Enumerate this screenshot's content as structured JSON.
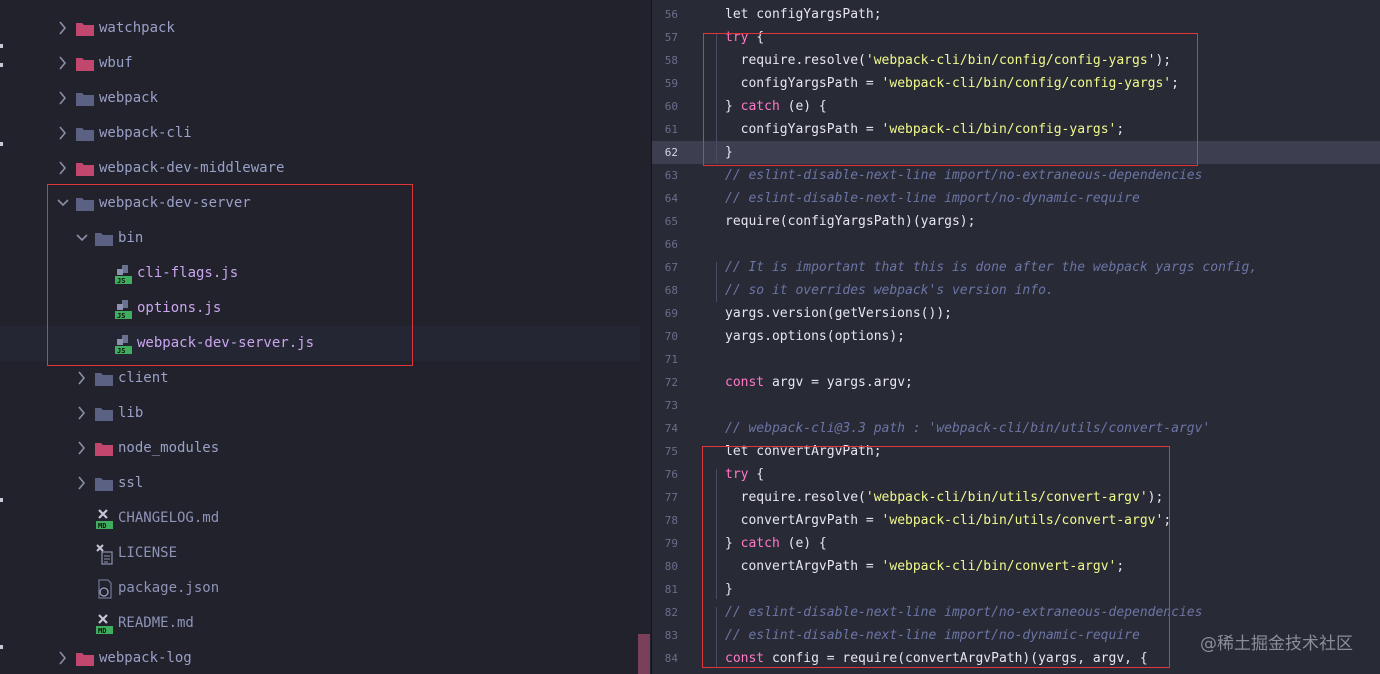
{
  "file_tree": {
    "items": [
      {
        "label": "watchpack",
        "type": "folder",
        "expanded": false,
        "color": "#c2476e"
      },
      {
        "label": "wbuf",
        "type": "folder",
        "expanded": false,
        "color": "#c2476e"
      },
      {
        "label": "webpack",
        "type": "folder",
        "expanded": false,
        "color": "#5b6183"
      },
      {
        "label": "webpack-cli",
        "type": "folder",
        "expanded": false,
        "color": "#5b6183"
      },
      {
        "label": "webpack-dev-middleware",
        "type": "folder",
        "expanded": false,
        "color": "#c2476e"
      },
      {
        "label": "webpack-dev-server",
        "type": "folder",
        "expanded": true,
        "color": "#5b6183"
      },
      {
        "label": "bin",
        "type": "folder",
        "expanded": true,
        "color": "#5b6183"
      },
      {
        "label": "cli-flags.js",
        "type": "js-file",
        "badge": "JS"
      },
      {
        "label": "options.js",
        "type": "js-file",
        "badge": "JS"
      },
      {
        "label": "webpack-dev-server.js",
        "type": "js-file",
        "badge": "JS"
      },
      {
        "label": "client",
        "type": "folder",
        "expanded": false,
        "color": "#5b6183"
      },
      {
        "label": "lib",
        "type": "folder",
        "expanded": false,
        "color": "#5b6183"
      },
      {
        "label": "node_modules",
        "type": "folder",
        "expanded": false,
        "color": "#c2476e"
      },
      {
        "label": "ssl",
        "type": "folder",
        "expanded": false,
        "color": "#5b6183"
      },
      {
        "label": "CHANGELOG.md",
        "type": "md-file",
        "badge": "MD"
      },
      {
        "label": "LICENSE",
        "type": "text-file"
      },
      {
        "label": "package.json",
        "type": "json-file"
      },
      {
        "label": "README.md",
        "type": "md-file",
        "badge": "MD"
      },
      {
        "label": "webpack-log",
        "type": "folder",
        "expanded": false,
        "color": "#c2476e"
      }
    ]
  },
  "editor": {
    "current_line": "62",
    "lines": [
      {
        "n": "56",
        "t": [
          [
            "p",
            "let configYargsPath;"
          ]
        ]
      },
      {
        "n": "57",
        "t": [
          [
            "k",
            "try"
          ],
          [
            "p",
            " {"
          ]
        ]
      },
      {
        "n": "58",
        "t": [
          [
            "p",
            "  require.resolve("
          ],
          [
            "s",
            "'webpack-cli/bin/config/config-yargs'"
          ],
          [
            "p",
            ");"
          ]
        ]
      },
      {
        "n": "59",
        "t": [
          [
            "p",
            "  configYargsPath = "
          ],
          [
            "s",
            "'webpack-cli/bin/config/config-yargs'"
          ],
          [
            "p",
            ";"
          ]
        ]
      },
      {
        "n": "60",
        "t": [
          [
            "p",
            "} "
          ],
          [
            "k",
            "catch"
          ],
          [
            "p",
            " (e) {"
          ]
        ]
      },
      {
        "n": "61",
        "t": [
          [
            "p",
            "  configYargsPath = "
          ],
          [
            "s",
            "'webpack-cli/bin/config-yargs'"
          ],
          [
            "p",
            ";"
          ]
        ]
      },
      {
        "n": "62",
        "t": [
          [
            "p",
            "}"
          ]
        ]
      },
      {
        "n": "63",
        "t": [
          [
            "c",
            "// eslint-disable-next-line import/no-extraneous-dependencies"
          ]
        ]
      },
      {
        "n": "64",
        "t": [
          [
            "c",
            "// eslint-disable-next-line import/no-dynamic-require"
          ]
        ]
      },
      {
        "n": "65",
        "t": [
          [
            "p",
            "require(configYargsPath)(yargs);"
          ]
        ]
      },
      {
        "n": "66",
        "t": []
      },
      {
        "n": "67",
        "t": [
          [
            "c",
            "// It is important that this is done after the webpack yargs config,"
          ]
        ]
      },
      {
        "n": "68",
        "t": [
          [
            "c",
            "// so it overrides webpack's version info."
          ]
        ]
      },
      {
        "n": "69",
        "t": [
          [
            "p",
            "yargs.version(getVersions());"
          ]
        ]
      },
      {
        "n": "70",
        "t": [
          [
            "p",
            "yargs.options(options);"
          ]
        ]
      },
      {
        "n": "71",
        "t": []
      },
      {
        "n": "72",
        "t": [
          [
            "k",
            "const"
          ],
          [
            "p",
            " argv = yargs.argv;"
          ]
        ]
      },
      {
        "n": "73",
        "t": []
      },
      {
        "n": "74",
        "t": [
          [
            "c",
            "// webpack-cli@3.3 path : 'webpack-cli/bin/utils/convert-argv'"
          ]
        ]
      },
      {
        "n": "75",
        "t": [
          [
            "p",
            "let convertArgvPath;"
          ]
        ]
      },
      {
        "n": "76",
        "t": [
          [
            "k",
            "try"
          ],
          [
            "p",
            " {"
          ]
        ]
      },
      {
        "n": "77",
        "t": [
          [
            "p",
            "  require.resolve("
          ],
          [
            "s",
            "'webpack-cli/bin/utils/convert-argv'"
          ],
          [
            "p",
            ");"
          ]
        ]
      },
      {
        "n": "78",
        "t": [
          [
            "p",
            "  convertArgvPath = "
          ],
          [
            "s",
            "'webpack-cli/bin/utils/convert-argv'"
          ],
          [
            "p",
            ";"
          ]
        ]
      },
      {
        "n": "79",
        "t": [
          [
            "p",
            "} "
          ],
          [
            "k",
            "catch"
          ],
          [
            "p",
            " (e) {"
          ]
        ]
      },
      {
        "n": "80",
        "t": [
          [
            "p",
            "  convertArgvPath = "
          ],
          [
            "s",
            "'webpack-cli/bin/convert-argv'"
          ],
          [
            "p",
            ";"
          ]
        ]
      },
      {
        "n": "81",
        "t": [
          [
            "p",
            "}"
          ]
        ]
      },
      {
        "n": "82",
        "t": [
          [
            "c",
            "// eslint-disable-next-line import/no-extraneous-dependencies"
          ]
        ]
      },
      {
        "n": "83",
        "t": [
          [
            "c",
            "// eslint-disable-next-line import/no-dynamic-require"
          ]
        ]
      },
      {
        "n": "84",
        "t": [
          [
            "k",
            "const"
          ],
          [
            "p",
            " config = require(convertArgvPath)(yargs, argv, {"
          ]
        ]
      }
    ]
  },
  "watermark": "@稀土掘金技术社区",
  "colors": {
    "keyword": "#ff79c6",
    "string": "#f1fa8c",
    "comment": "#6c75a4",
    "highlight_box": "#e0353a"
  }
}
